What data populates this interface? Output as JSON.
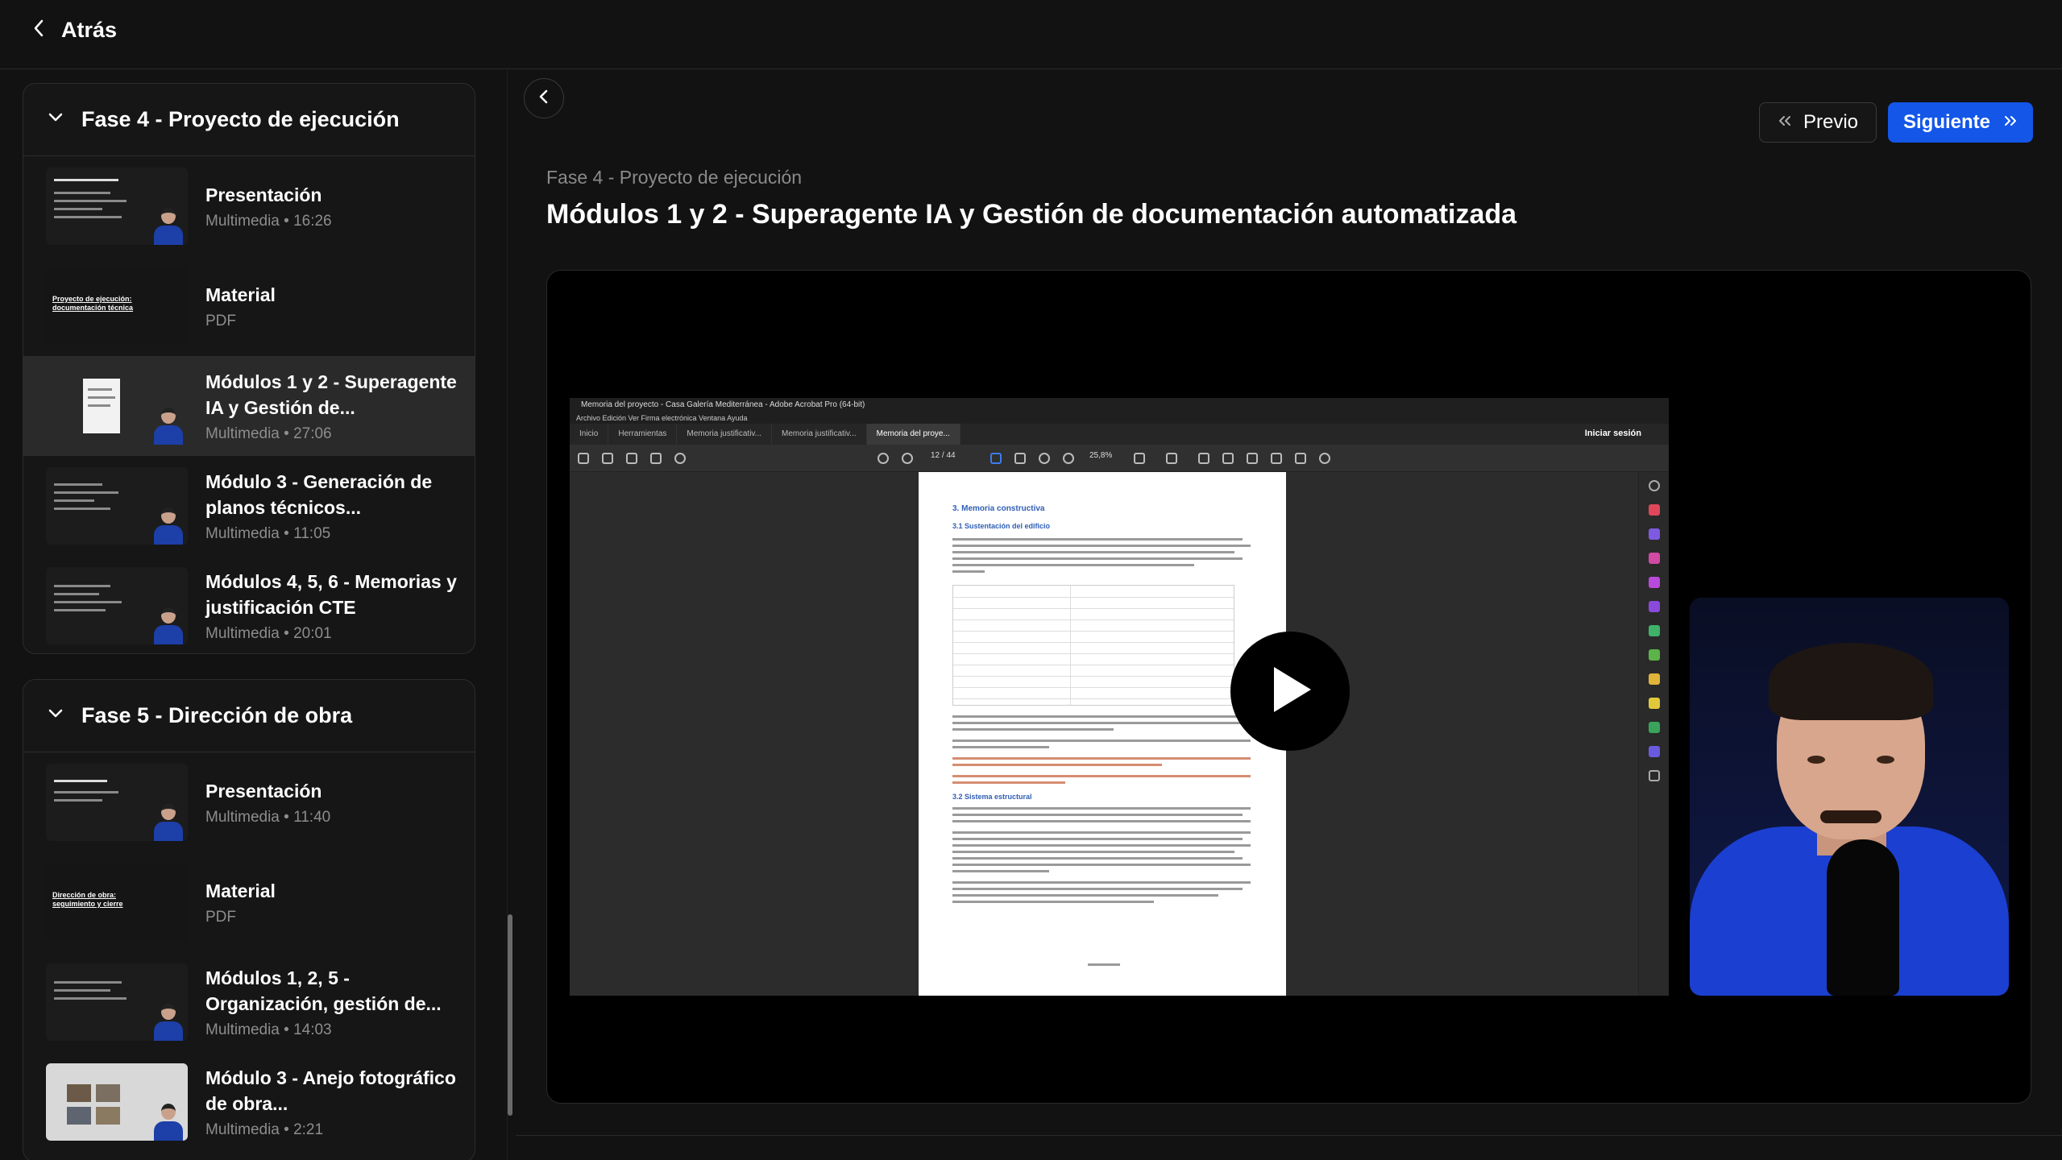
{
  "topbar": {
    "back_label": "Atrás"
  },
  "sidebar": {
    "phases": [
      {
        "title": "Fase 4 - Proyecto de ejecución",
        "items": [
          {
            "title": "Presentación",
            "meta": "Multimedia • 16:26",
            "active": false
          },
          {
            "title": "Material",
            "meta": "PDF",
            "thumb_caption": "Proyecto de ejecución: documentación técnica",
            "active": false
          },
          {
            "title": "Módulos 1 y 2 - Superagente IA y Gestión de...",
            "meta": "Multimedia • 27:06",
            "active": true
          },
          {
            "title": "Módulo 3 - Generación de planos técnicos...",
            "meta": "Multimedia • 11:05",
            "active": false
          },
          {
            "title": "Módulos 4, 5, 6 - Memorias y justificación CTE",
            "meta": "Multimedia • 20:01",
            "active": false
          }
        ]
      },
      {
        "title": "Fase 5 - Dirección de obra",
        "items": [
          {
            "title": "Presentación",
            "meta": "Multimedia • 11:40",
            "active": false
          },
          {
            "title": "Material",
            "meta": "PDF",
            "thumb_caption": "Dirección de obra: seguimiento y cierre",
            "active": false
          },
          {
            "title": "Módulos 1, 2, 5 - Organización, gestión de...",
            "meta": "Multimedia • 14:03",
            "active": false
          },
          {
            "title": "Módulo 3 - Anejo fotográfico de obra...",
            "meta": "Multimedia • 2:21",
            "active": false
          }
        ]
      }
    ]
  },
  "main": {
    "prev_label": "Previo",
    "next_label": "Siguiente",
    "breadcrumb": "Fase 4 - Proyecto de ejecución",
    "title": "Módulos 1 y 2 - Superagente IA y Gestión de documentación automatizada"
  },
  "video": {
    "window_title": "Memoria del proyecto - Casa Galería Mediterránea - Adobe Acrobat Pro (64-bit)",
    "menu": "Archivo   Edición   Ver   Firma electrónica   Ventana   Ayuda",
    "tabs": [
      "Inicio",
      "Herramientas",
      "Memoria justificativ...",
      "Memoria justificativ...",
      "Memoria del proye..."
    ],
    "signin": "Iniciar sesión",
    "page_indicator": "12 / 44",
    "zoom": "25,8%",
    "doc_heading": "3. Memoria constructiva",
    "doc_subheading": "3.1 Sustentación del edificio",
    "doc_subheading2": "3.2 Sistema estructural"
  },
  "colors": {
    "accent": "#1356e8",
    "background": "#121212",
    "active_item": "#2a2a2a"
  }
}
